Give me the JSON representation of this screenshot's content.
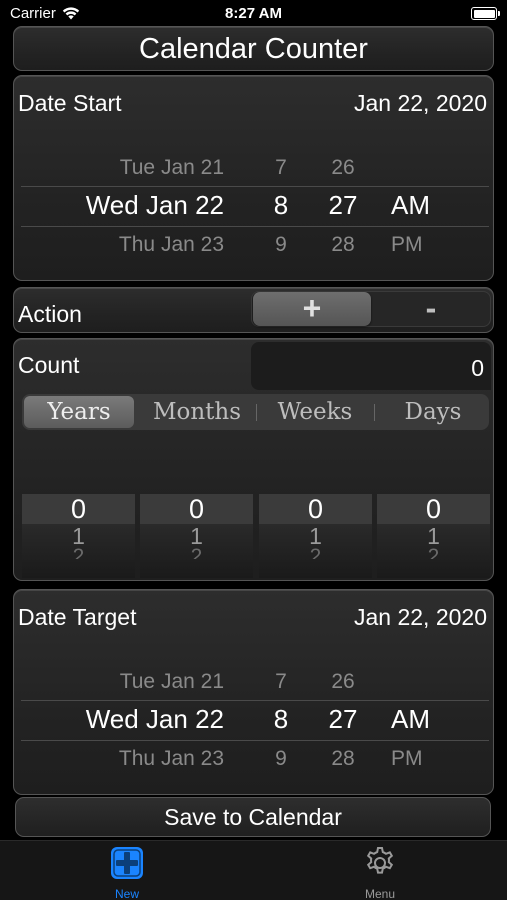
{
  "status_bar": {
    "carrier": "Carrier",
    "time": "8:27 AM"
  },
  "title": "Calendar Counter",
  "date_start": {
    "label": "Date Start",
    "value": "Jan 22, 2020",
    "picker": {
      "prev": {
        "day": "Tue Jan 21",
        "hour": "7",
        "minute": "26",
        "ampm": ""
      },
      "selected": {
        "day": "Wed Jan 22",
        "hour": "8",
        "minute": "27",
        "ampm": "AM"
      },
      "next": {
        "day": "Thu Jan 23",
        "hour": "9",
        "minute": "28",
        "ampm": "PM"
      }
    }
  },
  "action": {
    "label": "Action",
    "options": [
      "+",
      "-"
    ],
    "selected": "+"
  },
  "count": {
    "label": "Count",
    "value": "0",
    "units": [
      "Years",
      "Months",
      "Weeks",
      "Days"
    ],
    "selected_unit": "Years",
    "wheels": [
      {
        "selected": "0",
        "next": "1",
        "after": "2"
      },
      {
        "selected": "0",
        "next": "1",
        "after": "2"
      },
      {
        "selected": "0",
        "next": "1",
        "after": "2"
      },
      {
        "selected": "0",
        "next": "1",
        "after": "2"
      }
    ]
  },
  "date_target": {
    "label": "Date Target",
    "value": "Jan 22, 2020",
    "picker": {
      "prev": {
        "day": "Tue Jan 21",
        "hour": "7",
        "minute": "26",
        "ampm": ""
      },
      "selected": {
        "day": "Wed Jan 22",
        "hour": "8",
        "minute": "27",
        "ampm": "AM"
      },
      "next": {
        "day": "Thu Jan 23",
        "hour": "9",
        "minute": "28",
        "ampm": "PM"
      }
    }
  },
  "save_button": "Save to Calendar",
  "tabs": [
    {
      "label": "New",
      "icon": "plus-square-icon",
      "active": true
    },
    {
      "label": "Menu",
      "icon": "gear-icon",
      "active": false
    }
  ],
  "colors": {
    "accent": "#1a84ff"
  }
}
